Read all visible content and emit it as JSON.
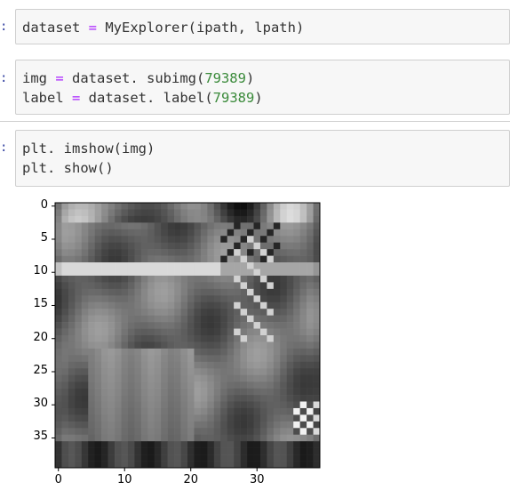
{
  "cells": [
    {
      "prompt": ":",
      "lines": [
        [
          {
            "t": "dataset",
            "c": "plain"
          },
          {
            "t": " = ",
            "c": "op"
          },
          {
            "t": "MyExplorer(ipath, lpath)",
            "c": "plain"
          }
        ]
      ]
    },
    {
      "prompt": ":",
      "lines": [
        [
          {
            "t": "img",
            "c": "plain"
          },
          {
            "t": " = ",
            "c": "op"
          },
          {
            "t": "dataset. subimg(",
            "c": "plain"
          },
          {
            "t": "79389",
            "c": "num"
          },
          {
            "t": ")",
            "c": "plain"
          }
        ],
        [
          {
            "t": "label",
            "c": "plain"
          },
          {
            "t": " = ",
            "c": "op"
          },
          {
            "t": "dataset. label(",
            "c": "plain"
          },
          {
            "t": "79389",
            "c": "num"
          },
          {
            "t": ")",
            "c": "plain"
          }
        ]
      ]
    },
    {
      "prompt": ":",
      "lines": [
        [
          {
            "t": "plt. imshow(img)",
            "c": "plain"
          }
        ],
        [
          {
            "t": "plt. show()",
            "c": "plain"
          }
        ]
      ]
    }
  ],
  "colors": {
    "prompt": "#303f9f",
    "operator": "#aa22ff",
    "number": "#3a8a3a",
    "code": "#333333",
    "cell_bg": "#f7f7f7",
    "cell_border": "#cfcfcf"
  },
  "chart_data": {
    "type": "heatmap",
    "colormap": "grayscale",
    "image_size": [
      40,
      40
    ],
    "xticks": [
      0,
      10,
      20,
      30
    ],
    "yticks": [
      0,
      5,
      10,
      15,
      20,
      25,
      30,
      35
    ],
    "xlim": [
      -0.5,
      39.5
    ],
    "ylim": [
      39.5,
      -0.5
    ]
  }
}
